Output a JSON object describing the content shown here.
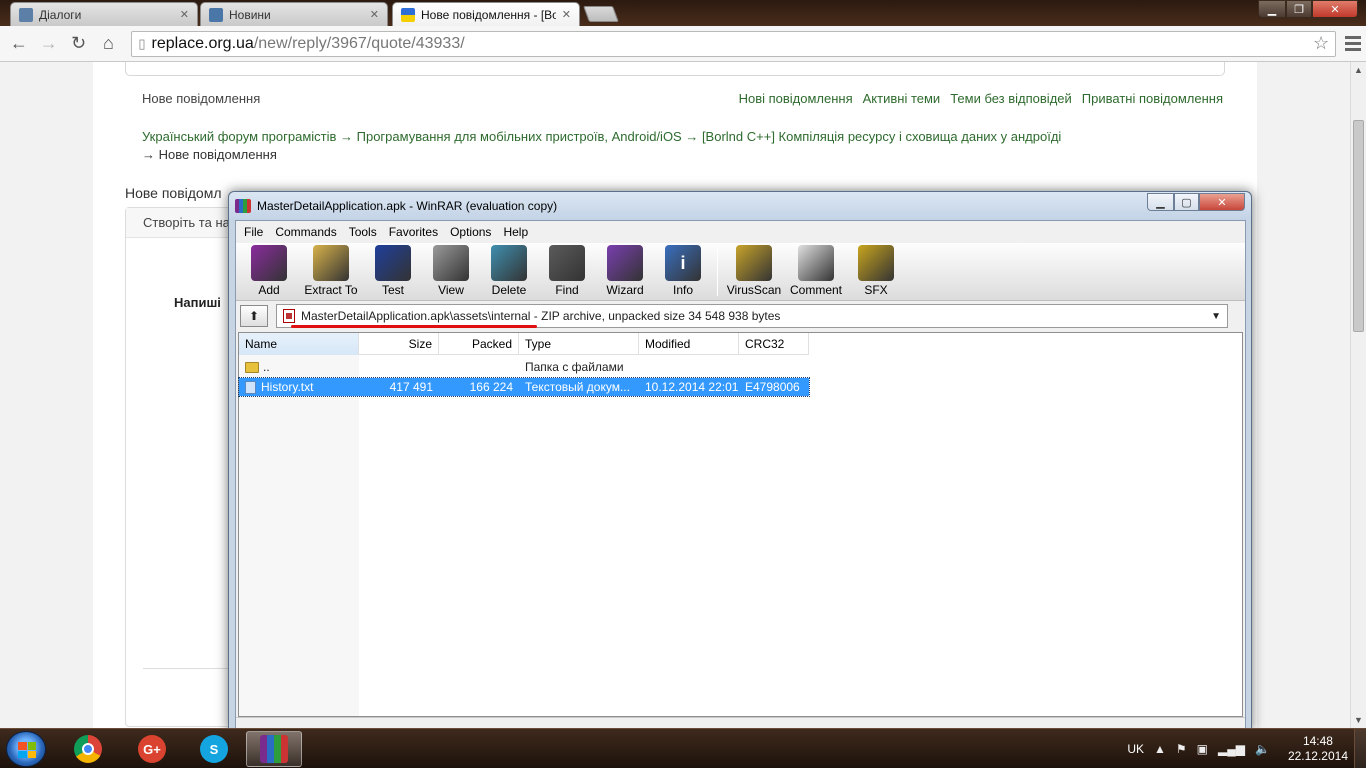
{
  "browser": {
    "tabs": [
      {
        "label": "Діалоги",
        "favicon_color": "#5b7fa6",
        "active": false
      },
      {
        "label": "Новини",
        "favicon_color": "#4a76a8",
        "active": false
      },
      {
        "label": "Нове повідомлення - [Bo",
        "favicon_color": "#f5d000",
        "active": true
      }
    ],
    "url": {
      "host": "replace.org.ua",
      "path": "/new/reply/3967/quote/43933/"
    }
  },
  "page": {
    "crumb_title": "Нове повідомлення",
    "top_links": [
      "Нові повідомлення",
      "Активні теми",
      "Теми без відповідей",
      "Приватні повідомлення"
    ],
    "breadcrumb": {
      "parts": "Український форум програмістів → Програмування для мобільних пристроїв, Android/iOS → [Borlnd C++] Компіляція ресурсу і сховища даних у андроїді",
      "current": "→ Нове повідомлення"
    },
    "new_message_heading": "Нове повідомл",
    "create_label": "Створіть та на",
    "write_label": "Напиші"
  },
  "winrar": {
    "title": "MasterDetailApplication.apk - WinRAR (evaluation copy)",
    "menu": [
      "File",
      "Commands",
      "Tools",
      "Favorites",
      "Options",
      "Help"
    ],
    "toolbar": [
      {
        "label": "Add",
        "icon": "books-icon",
        "color": "#8a2c9e"
      },
      {
        "label": "Extract To",
        "icon": "folder-extract-icon",
        "color": "#d8b24a"
      },
      {
        "label": "Test",
        "icon": "test-icon",
        "color": "#1f3f9c"
      },
      {
        "label": "View",
        "icon": "glasses-icon",
        "color": "#9a9a9a"
      },
      {
        "label": "Delete",
        "icon": "recycle-icon",
        "color": "#3f8fb0"
      },
      {
        "label": "Find",
        "icon": "binoculars-icon",
        "color": "#5b5b5b"
      },
      {
        "label": "Wizard",
        "icon": "wizard-icon",
        "color": "#7a3fb0"
      },
      {
        "label": "Info",
        "icon": "info-icon",
        "color": "#3a6fbf"
      },
      {
        "label": "VirusScan",
        "icon": "virusscan-icon",
        "color": "#c8a32a"
      },
      {
        "label": "Comment",
        "icon": "comment-icon",
        "color": "#e0e0e0"
      },
      {
        "label": "SFX",
        "icon": "sfx-icon",
        "color": "#c9a51e"
      }
    ],
    "path": {
      "archive_path": "MasterDetailApplication.apk\\assets\\internal",
      "description": " - ZIP archive, unpacked size 34 548 938 bytes"
    },
    "columns": {
      "name": "Name",
      "size": "Size",
      "packed": "Packed",
      "type": "Type",
      "modified": "Modified",
      "crc": "CRC32"
    },
    "rows": [
      {
        "name": "..",
        "size": "",
        "packed": "",
        "type": "Папка с файлами",
        "modified": "",
        "crc": "",
        "selected": false
      },
      {
        "name": "History.txt",
        "size": "417 491",
        "packed": "166 224",
        "type": "Текстовый докум...",
        "modified": "10.12.2014 22:01",
        "crc": "E4798006",
        "selected": true
      }
    ]
  },
  "taskbar": {
    "items": [
      {
        "name": "chrome",
        "color": "#e0b02a"
      },
      {
        "name": "google-plus",
        "color": "#d9432f",
        "label": "G+"
      },
      {
        "name": "skype",
        "color": "#14a4e0",
        "label": "S"
      },
      {
        "name": "winrar",
        "color": "#7b2b8c"
      }
    ],
    "lang": "UK",
    "time": "14:48",
    "date": "22.12.2014"
  }
}
